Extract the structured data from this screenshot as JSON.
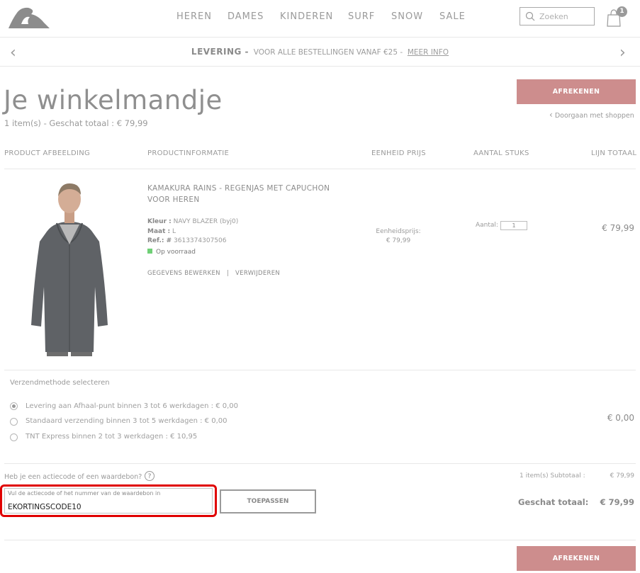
{
  "header": {
    "nav": [
      "HEREN",
      "DAMES",
      "KINDEREN",
      "SURF",
      "SNOW",
      "SALE"
    ],
    "search_placeholder": "Zoeken",
    "cart_count": "1"
  },
  "promo": {
    "strong": "LEVERING -",
    "text": "VOOR ALLE BESTELLINGEN VANAF €25 -",
    "link": "MEER INFO"
  },
  "page": {
    "title": "Je winkelmandje",
    "summary": "1 item(s) - Geschat totaal : € 79,99",
    "checkout_label": "AFREKENEN",
    "continue_label": "Doorgaan met shoppen"
  },
  "table_headers": [
    "PRODUCT AFBEELDING",
    "PRODUCTINFORMATIE",
    "EENHEID PRIJS",
    "AANTAL STUKS",
    "LIJN TOTAAL"
  ],
  "product": {
    "name_line1": "KAMAKURA RAINS - REGENJAS MET CAPUCHON",
    "name_line2": "VOOR HEREN",
    "color_label": "Kleur :",
    "color_value": "NAVY BLAZER (byj0)",
    "size_label": "Maat :",
    "size_value": "L",
    "ref_label": "Ref.: #",
    "ref_value": "3613374307506",
    "stock": "Op voorraad",
    "edit_label": "GEGEVENS BEWERKEN",
    "separator": "|",
    "remove_label": "VERWIJDEREN",
    "unit_label": "Eenheidsprijs:",
    "unit_price": "€ 79,99",
    "qty_label": "Aantal:",
    "qty": "1",
    "line_total": "€ 79,99"
  },
  "shipping": {
    "title": "Verzendmethode selecteren",
    "options": [
      "Levering aan Afhaal-punt binnen 3 tot 6 werkdagen : € 0,00",
      "Standaard verzending binnen 3 tot 5 werkdagen : € 0,00",
      "TNT Express binnen 2 tot 3 werkdagen : € 10,95"
    ],
    "selected_index": 0,
    "price": "€ 0,00"
  },
  "promo_code": {
    "question": "Heb je een actiecode of een waardebon?",
    "help": "?",
    "placeholder": "Vul de actiecode of het nummer van de waardebon in",
    "value": "EKORTINGSCODE10",
    "apply_label": "TOEPASSEN"
  },
  "totals": {
    "subtotal_label": "1 item(s) Subtotaal :",
    "subtotal_value": "€ 79,99",
    "total_label": "Geschat totaal:",
    "total_value": "€ 79,99"
  },
  "colors": {
    "accent": "#cd8d8d",
    "highlight": "#e00000",
    "in_stock": "#6fcf76"
  }
}
